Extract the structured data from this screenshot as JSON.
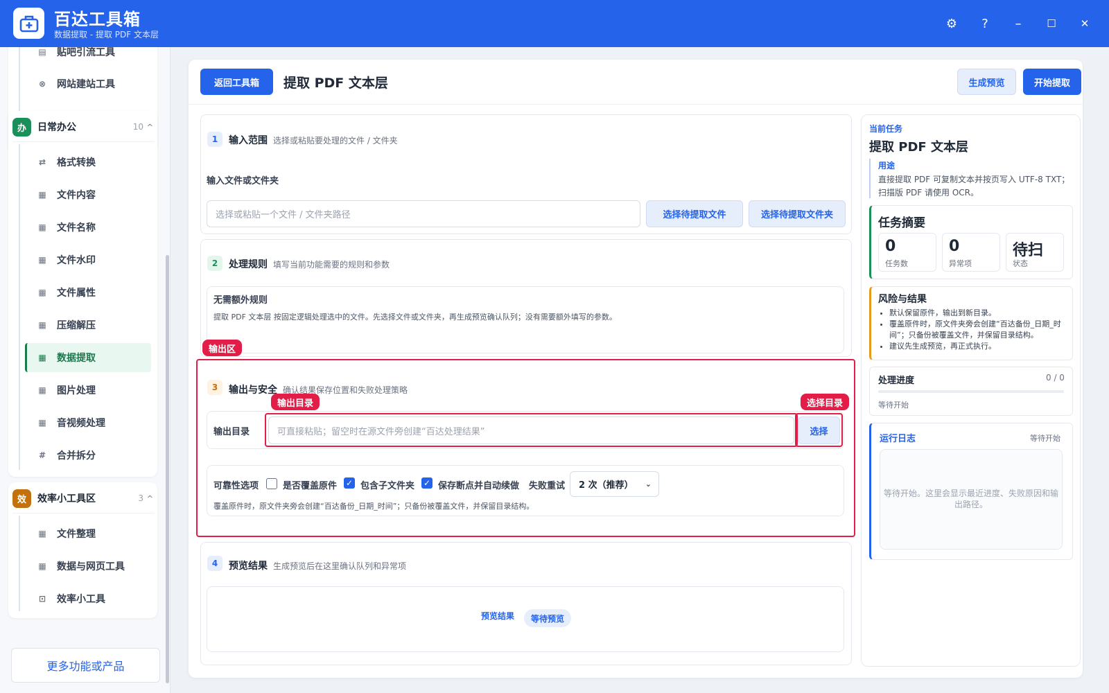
{
  "app": {
    "title": "百达工具箱",
    "subtitle": "数据提取 - 提取 PDF 文本层",
    "controls": {
      "settings": "⚙",
      "help": "?",
      "minimize": "–",
      "maximize": "☐",
      "close": "✕"
    }
  },
  "sidebar": {
    "top_items": [
      {
        "label": "贴吧引流工具",
        "icon": "doc-icon"
      },
      {
        "label": "网站建站工具",
        "icon": "globe-icon"
      }
    ],
    "groups": [
      {
        "badge": "办",
        "badge_color": "#1a8f5a",
        "name": "日常办公",
        "count": "10",
        "caret": "^",
        "items": [
          {
            "label": "格式转换",
            "icon": "swap-icon"
          },
          {
            "label": "文件内容",
            "icon": "grid-icon"
          },
          {
            "label": "文件名称",
            "icon": "grid-icon"
          },
          {
            "label": "文件水印",
            "icon": "grid-icon"
          },
          {
            "label": "文件属性",
            "icon": "grid-icon"
          },
          {
            "label": "压缩解压",
            "icon": "grid-icon"
          },
          {
            "label": "数据提取",
            "icon": "grid-icon",
            "active": true
          },
          {
            "label": "图片处理",
            "icon": "grid-icon"
          },
          {
            "label": "音视频处理",
            "icon": "grid-icon"
          },
          {
            "label": "合并拆分",
            "icon": "hash-icon"
          }
        ]
      },
      {
        "badge": "效",
        "badge_color": "#c2710c",
        "name": "效率小工具区",
        "count": "3",
        "caret": "^",
        "items": [
          {
            "label": "文件整理",
            "icon": "grid-icon"
          },
          {
            "label": "数据与网页工具",
            "icon": "grid-icon"
          },
          {
            "label": "效率小工具",
            "icon": "toolbox-icon"
          }
        ]
      }
    ],
    "more_button": "更多功能或产品"
  },
  "header": {
    "back_button": "返回工具箱",
    "title": "提取 PDF 文本层",
    "preview_button": "生成预览",
    "start_button": "开始提取"
  },
  "sections": {
    "input": {
      "num": "1",
      "title": "输入范围",
      "desc": "选择或粘贴要处理的文件 / 文件夹",
      "field_label": "输入文件或文件夹",
      "placeholder": "选择或粘贴一个文件 / 文件夹路径",
      "choose_file": "选择待提取文件",
      "choose_folder": "选择待提取文件夹"
    },
    "rules": {
      "num": "2",
      "title": "处理规则",
      "desc": "填写当前功能需要的规则和参数",
      "box_title": "无需额外规则",
      "box_text": "提取 PDF 文本层 按固定逻辑处理选中的文件。先选择文件或文件夹，再生成预览确认队列；没有需要额外填写的参数。"
    },
    "output": {
      "tag": "输出区",
      "num": "3",
      "title": "输出与安全",
      "desc": "确认结果保存位置和失败处理策略",
      "dir_tag": "输出目录",
      "select_tag": "选择目录",
      "dir_label": "输出目录",
      "dir_placeholder": "可直接粘贴；留空时在源文件旁创建“百达处理结果”",
      "select_button": "选择",
      "reliability_label": "可靠性选项",
      "overwrite_label": "是否覆盖原件",
      "overwrite_checked": false,
      "subfolder_label": "包含子文件夹",
      "subfolder_checked": true,
      "resume_label": "保存断点并自动续做",
      "resume_checked": true,
      "retry_label": "失败重试",
      "retry_value": "2 次（推荐）",
      "note": "覆盖原件时，原文件夹旁会创建“百达备份_日期_时间”；只备份被覆盖文件，并保留目录结构。"
    },
    "preview": {
      "num": "4",
      "title": "预览结果",
      "desc": "生成预览后在这里确认队列和异常项",
      "label": "预览结果",
      "badge": "等待预览"
    }
  },
  "right_panel": {
    "current_label": "当前任务",
    "task_title": "提取 PDF 文本层",
    "usage_label": "用途",
    "usage_text": "直接提取 PDF 可复制文本并按页写入 UTF-8 TXT；扫描版 PDF 请使用 OCR。",
    "summary_title": "任务摘要",
    "stats": [
      {
        "value": "0",
        "label": "任务数"
      },
      {
        "value": "0",
        "label": "异常项"
      },
      {
        "value": "待扫",
        "label": "状态"
      }
    ],
    "risk_title": "风险与结果",
    "risk_items": [
      "默认保留原件，输出到新目录。",
      "覆盖原件时，原文件夹旁会创建“百达备份_日期_时间”；只备份被覆盖文件，并保留目录结构。",
      "建议先生成预览，再正式执行。"
    ],
    "progress_title": "处理进度",
    "progress_count": "0 / 0",
    "progress_fraction": 0,
    "progress_status": "等待开始",
    "log_title": "运行日志",
    "log_status": "等待开始",
    "log_placeholder": "等待开始。这里会显示最近进度、失败原因和输出路径。"
  }
}
